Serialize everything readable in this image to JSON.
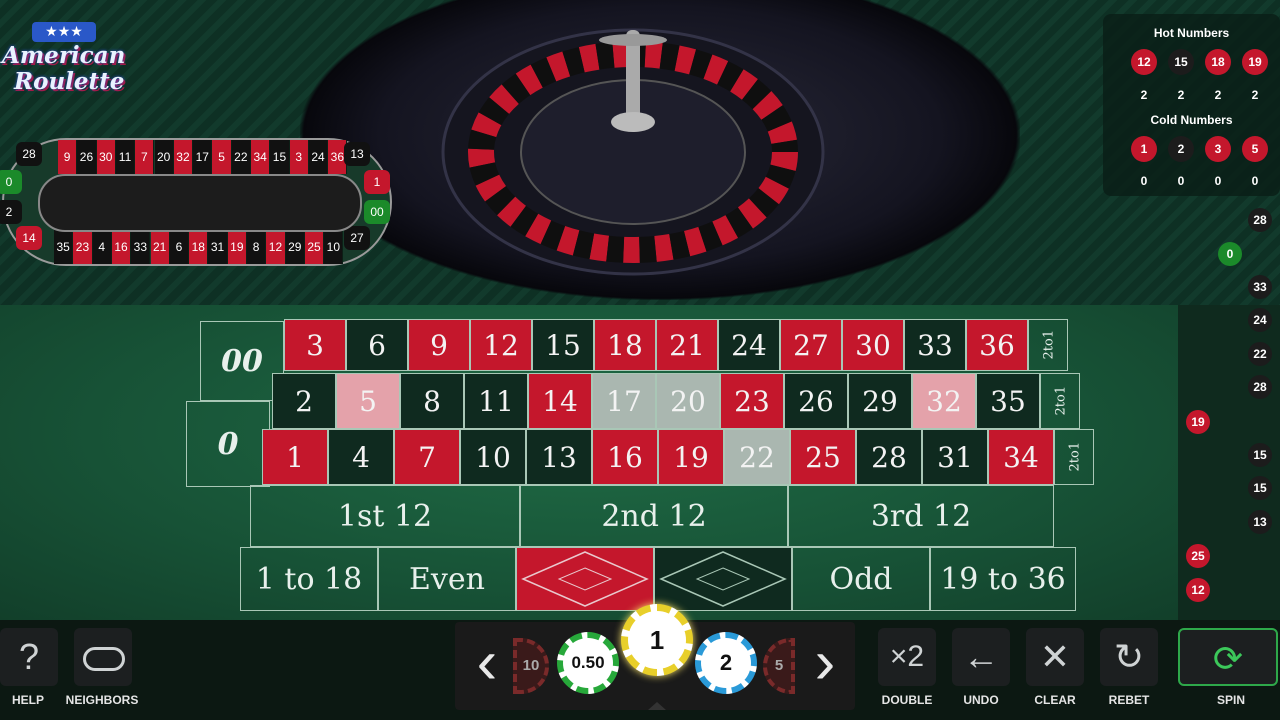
{
  "logo": {
    "line1": "American",
    "line2": "Roulette",
    "stars": "★★★"
  },
  "racetrack": {
    "top": [
      "9",
      "26",
      "30",
      "11",
      "7",
      "20",
      "32",
      "17",
      "5",
      "22",
      "34",
      "15",
      "3",
      "24",
      "36"
    ],
    "top_colors": [
      "r",
      "b",
      "r",
      "b",
      "r",
      "b",
      "r",
      "b",
      "r",
      "b",
      "r",
      "b",
      "r",
      "b",
      "r"
    ],
    "bottom": [
      "35",
      "23",
      "4",
      "16",
      "33",
      "21",
      "6",
      "18",
      "31",
      "19",
      "8",
      "12",
      "29",
      "25",
      "10"
    ],
    "bottom_colors": [
      "b",
      "r",
      "b",
      "r",
      "b",
      "r",
      "b",
      "r",
      "b",
      "r",
      "b",
      "r",
      "b",
      "r",
      "b"
    ],
    "left": [
      "28",
      "0",
      "2",
      "14"
    ],
    "right": [
      "13",
      "1",
      "00",
      "27"
    ]
  },
  "stats": {
    "hot_title": "Hot Numbers",
    "hot": [
      {
        "n": "12",
        "c": "#c4172c",
        "count": "2"
      },
      {
        "n": "15",
        "c": "#1c1c1c",
        "count": "2"
      },
      {
        "n": "18",
        "c": "#c4172c",
        "count": "2"
      },
      {
        "n": "19",
        "c": "#c4172c",
        "count": "2"
      }
    ],
    "cold_title": "Cold Numbers",
    "cold": [
      {
        "n": "1",
        "c": "#c4172c",
        "count": "0"
      },
      {
        "n": "2",
        "c": "#1c1c1c",
        "count": "0"
      },
      {
        "n": "3",
        "c": "#c4172c",
        "count": "0"
      },
      {
        "n": "5",
        "c": "#c4172c",
        "count": "0"
      }
    ]
  },
  "history": [
    {
      "n": "28",
      "c": "#1c1c1c",
      "side": "r"
    },
    {
      "n": "0",
      "c": "#1b8a2a",
      "side": "m"
    },
    {
      "n": "33",
      "c": "#1c1c1c",
      "side": "r"
    },
    {
      "n": "24",
      "c": "#1c1c1c",
      "side": "r"
    },
    {
      "n": "22",
      "c": "#1c1c1c",
      "side": "r"
    },
    {
      "n": "28",
      "c": "#1c1c1c",
      "side": "r"
    },
    {
      "n": "19",
      "c": "#c4172c",
      "side": "l"
    },
    {
      "n": "15",
      "c": "#1c1c1c",
      "side": "r"
    },
    {
      "n": "15",
      "c": "#1c1c1c",
      "side": "r"
    },
    {
      "n": "13",
      "c": "#1c1c1c",
      "side": "r"
    },
    {
      "n": "25",
      "c": "#c4172c",
      "side": "l"
    },
    {
      "n": "12",
      "c": "#c4172c",
      "side": "l"
    }
  ],
  "table": {
    "zero": "0",
    "double_zero": "00",
    "rows": [
      [
        {
          "n": "3",
          "s": "red"
        },
        {
          "n": "6",
          "s": "blk"
        },
        {
          "n": "9",
          "s": "red"
        },
        {
          "n": "12",
          "s": "red"
        },
        {
          "n": "15",
          "s": "blk"
        },
        {
          "n": "18",
          "s": "red"
        },
        {
          "n": "21",
          "s": "red"
        },
        {
          "n": "24",
          "s": "blk"
        },
        {
          "n": "27",
          "s": "red"
        },
        {
          "n": "30",
          "s": "red"
        },
        {
          "n": "33",
          "s": "blk"
        },
        {
          "n": "36",
          "s": "red"
        }
      ],
      [
        {
          "n": "2",
          "s": "blk"
        },
        {
          "n": "5",
          "s": "hl-red"
        },
        {
          "n": "8",
          "s": "blk"
        },
        {
          "n": "11",
          "s": "blk"
        },
        {
          "n": "14",
          "s": "red"
        },
        {
          "n": "17",
          "s": "hl-blk"
        },
        {
          "n": "20",
          "s": "hl-blk"
        },
        {
          "n": "23",
          "s": "red"
        },
        {
          "n": "26",
          "s": "blk"
        },
        {
          "n": "29",
          "s": "blk"
        },
        {
          "n": "32",
          "s": "hl-red"
        },
        {
          "n": "35",
          "s": "blk"
        }
      ],
      [
        {
          "n": "1",
          "s": "red"
        },
        {
          "n": "4",
          "s": "blk"
        },
        {
          "n": "7",
          "s": "red"
        },
        {
          "n": "10",
          "s": "blk"
        },
        {
          "n": "13",
          "s": "blk"
        },
        {
          "n": "16",
          "s": "red"
        },
        {
          "n": "19",
          "s": "red"
        },
        {
          "n": "22",
          "s": "hl-blk"
        },
        {
          "n": "25",
          "s": "red"
        },
        {
          "n": "28",
          "s": "blk"
        },
        {
          "n": "31",
          "s": "blk"
        },
        {
          "n": "34",
          "s": "red"
        }
      ]
    ],
    "col_bets": [
      "2to1",
      "2to1",
      "2to1"
    ],
    "dozens": [
      "1st 12",
      "2nd 12",
      "3rd 12"
    ],
    "outside": {
      "low": "1 to 18",
      "even": "Even",
      "odd": "Odd",
      "high": "19 to 36"
    }
  },
  "controls": {
    "help": {
      "icon": "?",
      "label": "HELP"
    },
    "neighbors": {
      "label": "NEIGHBORS"
    },
    "double": {
      "icon": "×2",
      "label": "DOUBLE"
    },
    "undo": {
      "icon": "←",
      "label": "UNDO"
    },
    "clear": {
      "icon": "✕",
      "label": "CLEAR"
    },
    "rebet": {
      "icon": "↻",
      "label": "REBET"
    },
    "spin": {
      "icon": "⟳",
      "label": "SPIN"
    }
  },
  "chips": {
    "prev": "‹",
    "next": "›",
    "left_partial": "10",
    "chip1": "0.50",
    "selected": "1",
    "chip3": "2",
    "right_partial": "5"
  },
  "colors": {
    "red": "#c4172c",
    "black": "#0f2a1f",
    "green": "#1b8a2a",
    "felt": "#1a5a3a"
  }
}
